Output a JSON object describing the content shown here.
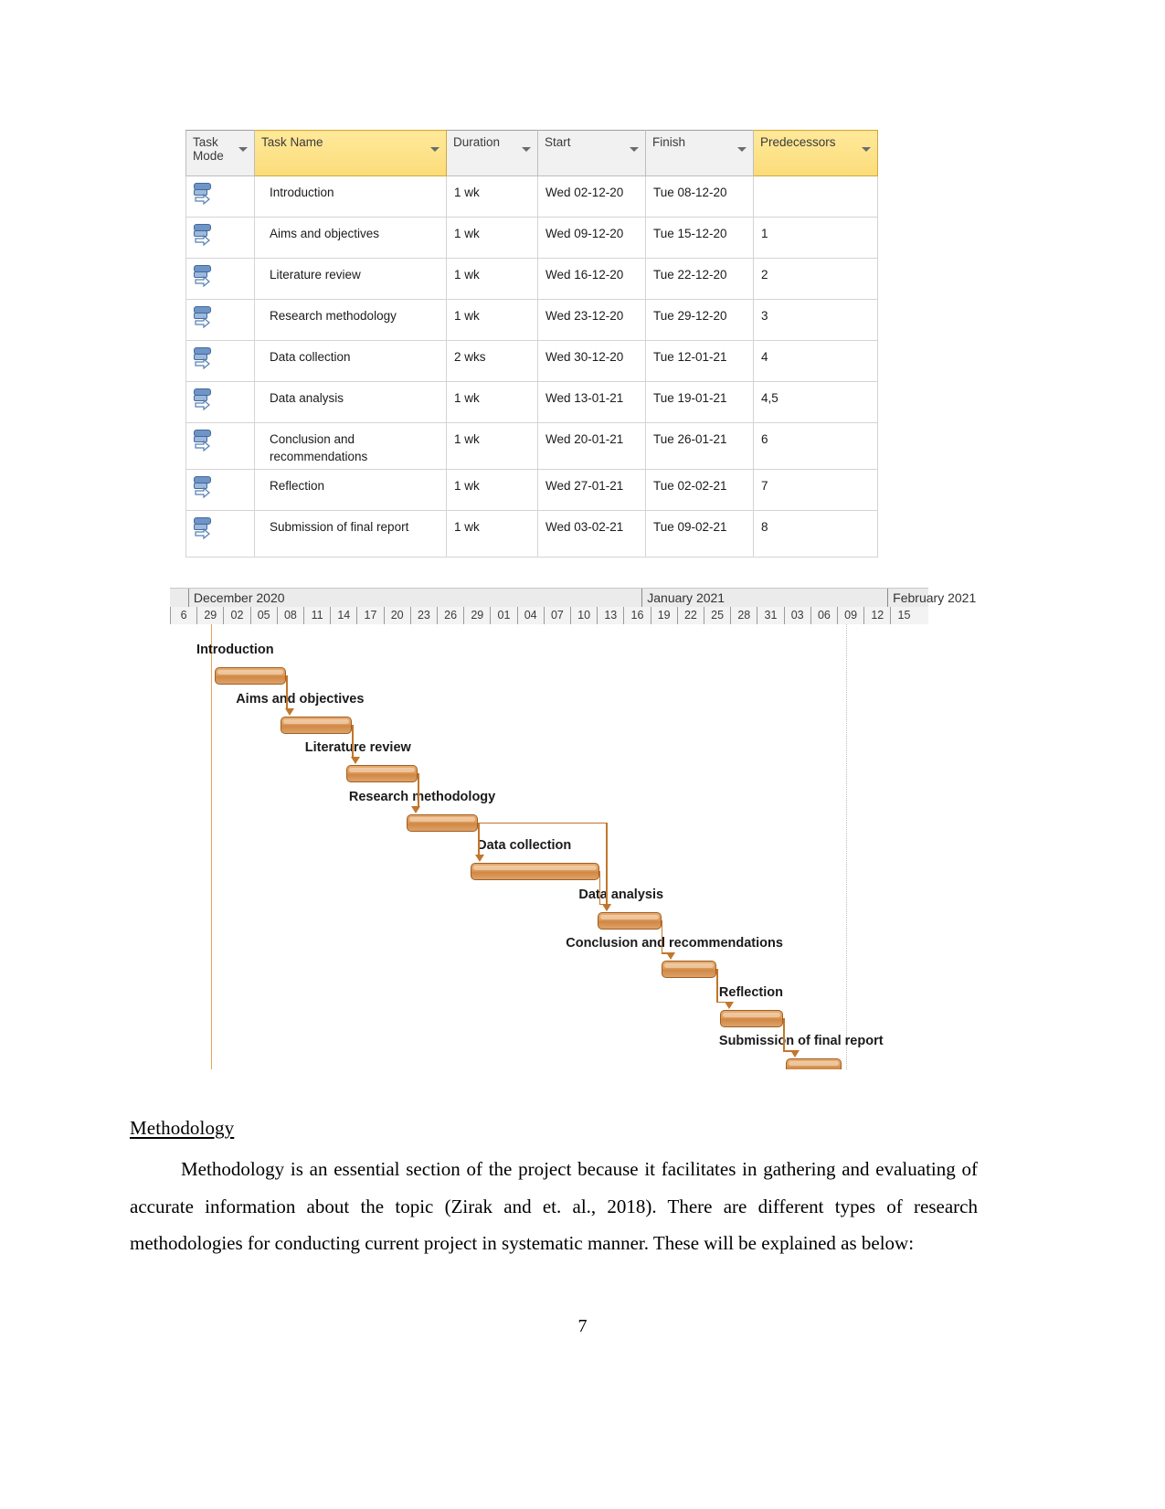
{
  "project_table": {
    "columns": [
      {
        "label": "Task Mode",
        "highlight": false
      },
      {
        "label": "Task Name",
        "highlight": true
      },
      {
        "label": "Duration",
        "highlight": false
      },
      {
        "label": "Start",
        "highlight": false
      },
      {
        "label": "Finish",
        "highlight": false
      },
      {
        "label": "Predecessors",
        "highlight": true
      }
    ],
    "rows": [
      {
        "mode": "auto-schedule-icon",
        "name": "Introduction",
        "duration": "1 wk",
        "start": "Wed 02-12-20",
        "finish": "Tue 08-12-20",
        "predecessors": ""
      },
      {
        "mode": "auto-schedule-icon",
        "name": "Aims and objectives",
        "duration": "1 wk",
        "start": "Wed 09-12-20",
        "finish": "Tue 15-12-20",
        "predecessors": "1"
      },
      {
        "mode": "auto-schedule-icon",
        "name": "Literature review",
        "duration": "1 wk",
        "start": "Wed 16-12-20",
        "finish": "Tue 22-12-20",
        "predecessors": "2"
      },
      {
        "mode": "auto-schedule-icon",
        "name": "Research methodology",
        "duration": "1 wk",
        "start": "Wed 23-12-20",
        "finish": "Tue 29-12-20",
        "predecessors": "3"
      },
      {
        "mode": "auto-schedule-icon",
        "name": "Data collection",
        "duration": "2 wks",
        "start": "Wed 30-12-20",
        "finish": "Tue 12-01-21",
        "predecessors": "4"
      },
      {
        "mode": "auto-schedule-icon",
        "name": "Data analysis",
        "duration": "1 wk",
        "start": "Wed 13-01-21",
        "finish": "Tue 19-01-21",
        "predecessors": "4,5"
      },
      {
        "mode": "auto-schedule-icon",
        "name": "Conclusion and recommendations",
        "duration": "1 wk",
        "start": "Wed 20-01-21",
        "finish": "Tue 26-01-21",
        "predecessors": "6"
      },
      {
        "mode": "auto-schedule-icon",
        "name": "Reflection",
        "duration": "1 wk",
        "start": "Wed 27-01-21",
        "finish": "Tue 02-02-21",
        "predecessors": "7"
      },
      {
        "mode": "auto-schedule-icon",
        "name": "Submission of final report",
        "duration": "1 wk",
        "start": "Wed 03-02-21",
        "finish": "Tue 09-02-21",
        "predecessors": "8"
      }
    ]
  },
  "chart_data": {
    "type": "bar",
    "chart_kind": "gantt",
    "title": "",
    "xlabel": "",
    "ylabel": "",
    "grid": true,
    "legend": "none",
    "timescale": {
      "months": [
        {
          "label": "December 2020",
          "start_pct": 2.4,
          "width_pct": 59.8
        },
        {
          "label": "January 2021",
          "start_pct": 62.2,
          "width_pct": 32.4
        },
        {
          "label": "February 2021",
          "start_pct": 94.6,
          "width_pct": 14.0
        }
      ],
      "day_ticks": [
        "6",
        "29",
        "02",
        "05",
        "08",
        "11",
        "14",
        "17",
        "20",
        "23",
        "26",
        "29",
        "01",
        "04",
        "07",
        "10",
        "13",
        "16",
        "19",
        "22",
        "25",
        "28",
        "31",
        "03",
        "06",
        "09",
        "12",
        "15"
      ],
      "axis_label_interval_days": 3
    },
    "tasks": [
      {
        "name": "Introduction",
        "start": "2020-12-02",
        "finish": "2020-12-08",
        "duration": "1 wk",
        "bar_start_pct": 5.9,
        "bar_width_pct": 9.4,
        "label_offset_pct": 3.5,
        "row": 0
      },
      {
        "name": "Aims and objectives",
        "start": "2020-12-09",
        "finish": "2020-12-15",
        "duration": "1 wk",
        "bar_start_pct": 14.6,
        "bar_width_pct": 9.4,
        "label_offset_pct": 8.7,
        "row": 1
      },
      {
        "name": "Literature review",
        "start": "2020-12-16",
        "finish": "2020-12-22",
        "duration": "1 wk",
        "bar_start_pct": 23.3,
        "bar_width_pct": 9.4,
        "label_offset_pct": 17.8,
        "row": 2
      },
      {
        "name": "Research methodology",
        "start": "2020-12-23",
        "finish": "2020-12-29",
        "duration": "1 wk",
        "bar_start_pct": 31.2,
        "bar_width_pct": 9.4,
        "label_offset_pct": 23.6,
        "row": 3
      },
      {
        "name": "Data collection",
        "start": "2020-12-30",
        "finish": "2021-01-12",
        "duration": "2 wks",
        "bar_start_pct": 39.6,
        "bar_width_pct": 17.0,
        "label_offset_pct": 40.5,
        "row": 4
      },
      {
        "name": "Data analysis",
        "start": "2021-01-13",
        "finish": "2021-01-19",
        "duration": "1 wk",
        "bar_start_pct": 56.4,
        "bar_width_pct": 8.4,
        "label_offset_pct": 53.9,
        "row": 5
      },
      {
        "name": "Conclusion and recommendations",
        "start": "2021-01-20",
        "finish": "2021-01-26",
        "duration": "1 wk",
        "bar_start_pct": 64.8,
        "bar_width_pct": 7.3,
        "label_offset_pct": 52.2,
        "row": 6
      },
      {
        "name": "Reflection",
        "start": "2021-01-27",
        "finish": "2021-02-02",
        "duration": "1 wk",
        "bar_start_pct": 72.5,
        "bar_width_pct": 8.4,
        "label_offset_pct": 72.4,
        "row": 7
      },
      {
        "name": "Submission of final report",
        "start": "2021-02-03",
        "finish": "2021-02-09",
        "duration": "1 wk",
        "bar_start_pct": 81.2,
        "bar_width_pct": 7.3,
        "label_offset_pct": 72.4,
        "row": 8
      }
    ],
    "dependencies": [
      {
        "from": "Introduction",
        "to": "Aims and objectives"
      },
      {
        "from": "Aims and objectives",
        "to": "Literature review"
      },
      {
        "from": "Literature review",
        "to": "Research methodology"
      },
      {
        "from": "Research methodology",
        "to": "Data collection"
      },
      {
        "from": "Research methodology",
        "to": "Data analysis"
      },
      {
        "from": "Data collection",
        "to": "Data analysis"
      },
      {
        "from": "Data analysis",
        "to": "Conclusion and recommendations"
      },
      {
        "from": "Conclusion and recommendations",
        "to": "Reflection"
      },
      {
        "from": "Reflection",
        "to": "Submission of final report"
      }
    ],
    "colors": {
      "bar_fill": "#dd9a57",
      "bar_border": "#9e5f22",
      "link": "#c2762b",
      "today_line": "#e8a05c",
      "header_highlight": "#fbdc7a"
    }
  },
  "document": {
    "heading": "Methodology",
    "paragraph": "Methodology is an essential section of the project because it facilitates in gathering and evaluating of accurate information about the topic (Zirak and et. al., 2018). There are different types of research methodologies for conducting current project in systematic manner. These will be explained as below:",
    "page_number": "7"
  }
}
